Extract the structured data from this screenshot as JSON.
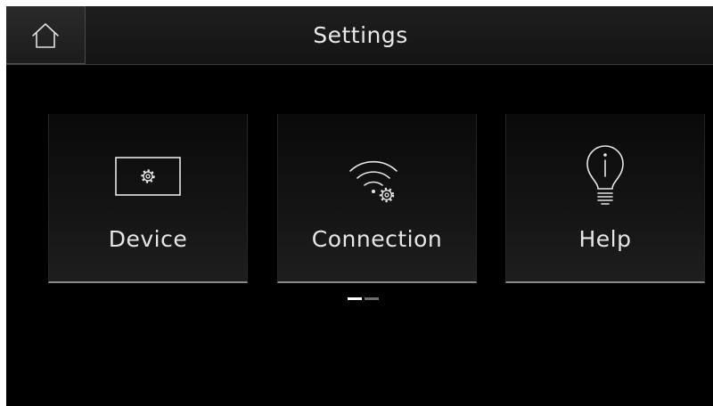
{
  "header": {
    "title": "Settings",
    "home_icon": "home-icon"
  },
  "tiles": [
    {
      "label": "Device",
      "icon": "device-settings-icon"
    },
    {
      "label": "Connection",
      "icon": "wifi-settings-icon"
    },
    {
      "label": "Help",
      "icon": "lightbulb-info-icon"
    }
  ],
  "pager": {
    "current_page": 1,
    "total_pages": 2
  },
  "colors": {
    "background": "#000000",
    "text": "#e6e6e6",
    "active_indicator": "#ffffff",
    "inactive_indicator": "#6e6e6e"
  }
}
